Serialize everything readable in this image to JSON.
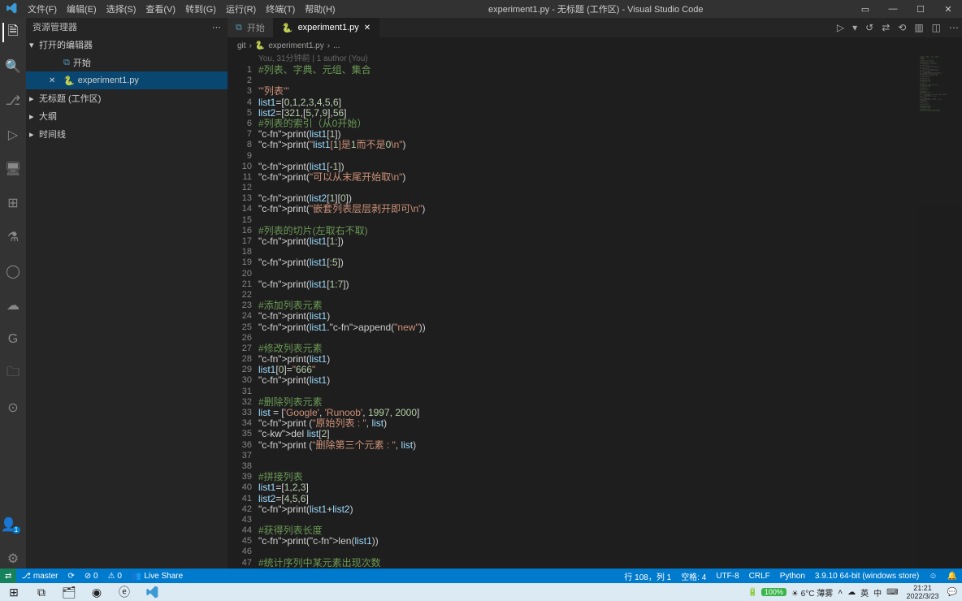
{
  "title": "experiment1.py - 无标题 (工作区) - Visual Studio Code",
  "menu": [
    "文件(F)",
    "编辑(E)",
    "选择(S)",
    "查看(V)",
    "转到(G)",
    "运行(R)",
    "终端(T)",
    "帮助(H)"
  ],
  "sidebar": {
    "header": "资源管理器",
    "sections": {
      "open_editors": "打开的编辑器",
      "untitled": "无标题 (工作区)",
      "outline": "大纲",
      "timeline": "时间线"
    },
    "open_items": [
      {
        "label": "开始"
      },
      {
        "label": "experiment1.py"
      }
    ]
  },
  "tabs": [
    {
      "label": "开始",
      "active": false
    },
    {
      "label": "experiment1.py",
      "active": true
    }
  ],
  "breadcrumb": {
    "a": "git",
    "b": "experiment1.py",
    "c": "..."
  },
  "annotation": "You, 31分钟前 | 1 author (You)",
  "code": [
    {
      "t": "comment",
      "s": "#列表、字典、元组、集合"
    },
    {
      "t": "blank",
      "s": ""
    },
    {
      "t": "string",
      "s": "'''列表'''"
    },
    {
      "t": "code",
      "s": "list1=[0,1,2,3,4,5,6]"
    },
    {
      "t": "code",
      "s": "list2=[321,[5,7,9],56]"
    },
    {
      "t": "comment",
      "s": "#列表的索引（从0开始）"
    },
    {
      "t": "print",
      "s": "print(list1[1])"
    },
    {
      "t": "printstr",
      "s": "print(\"list1[1]是1而不是0\\n\")"
    },
    {
      "t": "blank",
      "s": ""
    },
    {
      "t": "print",
      "s": "print(list1[-1])"
    },
    {
      "t": "printstr",
      "s": "print(\"可以从末尾开始取\\n\")"
    },
    {
      "t": "blank",
      "s": ""
    },
    {
      "t": "print",
      "s": "print(list2[1][0])"
    },
    {
      "t": "printstr",
      "s": "print(\"嵌套列表层层剥开即可\\n\")"
    },
    {
      "t": "blank",
      "s": ""
    },
    {
      "t": "comment",
      "s": "#列表的切片(左取右不取)"
    },
    {
      "t": "print",
      "s": "print(list1[1:])"
    },
    {
      "t": "blank",
      "s": ""
    },
    {
      "t": "print",
      "s": "print(list1[:5])"
    },
    {
      "t": "blank",
      "s": ""
    },
    {
      "t": "print",
      "s": "print(list1[1:7])"
    },
    {
      "t": "blank",
      "s": ""
    },
    {
      "t": "comment",
      "s": "#添加列表元素"
    },
    {
      "t": "print",
      "s": "print(list1)"
    },
    {
      "t": "printappend",
      "s": "print(list1.append(\"new\"))"
    },
    {
      "t": "blank",
      "s": ""
    },
    {
      "t": "comment",
      "s": "#修改列表元素"
    },
    {
      "t": "print",
      "s": "print(list1)"
    },
    {
      "t": "assignstr",
      "s": "list1[0]=\"666\""
    },
    {
      "t": "print",
      "s": "print(list1)"
    },
    {
      "t": "blank",
      "s": ""
    },
    {
      "t": "comment",
      "s": "#删除列表元素"
    },
    {
      "t": "listlit",
      "s": "list = ['Google', 'Runoob', 1997, 2000]"
    },
    {
      "t": "printspc",
      "s": "print (\"原始列表 : \", list)"
    },
    {
      "t": "del",
      "s": "del list[2]"
    },
    {
      "t": "printspc",
      "s": "print (\"删除第三个元素 : \", list)"
    },
    {
      "t": "blank",
      "s": ""
    },
    {
      "t": "blank",
      "s": ""
    },
    {
      "t": "comment",
      "s": "#拼接列表"
    },
    {
      "t": "code",
      "s": "list1=[1,2,3]"
    },
    {
      "t": "code",
      "s": "list2=[4,5,6]"
    },
    {
      "t": "print",
      "s": "print(list1+list2)"
    },
    {
      "t": "blank",
      "s": ""
    },
    {
      "t": "comment",
      "s": "#获得列表长度"
    },
    {
      "t": "print",
      "s": "print(len(list1))"
    },
    {
      "t": "blank",
      "s": ""
    },
    {
      "t": "comment",
      "s": "#统计序列中某元素出现次数"
    }
  ],
  "status": {
    "remote": "⇄",
    "branch": "master",
    "sync": "⟳",
    "err": "⊘ 0",
    "warn": "⚠ 0",
    "liveshare": "Live Share",
    "pos": "行 108，列 1",
    "spaces": "空格: 4",
    "enc": "UTF-8",
    "eol": "CRLF",
    "lang": "Python",
    "interp": "3.9.10 64-bit (windows store)",
    "feedback": "☺",
    "bell": "🔔"
  },
  "taskbar": {
    "weather": "6°C 薄雾",
    "battery": "100%",
    "ime1": "英",
    "ime2": "中",
    "ime3": "⌨",
    "time": "21:21",
    "date": "2022/3/23"
  }
}
